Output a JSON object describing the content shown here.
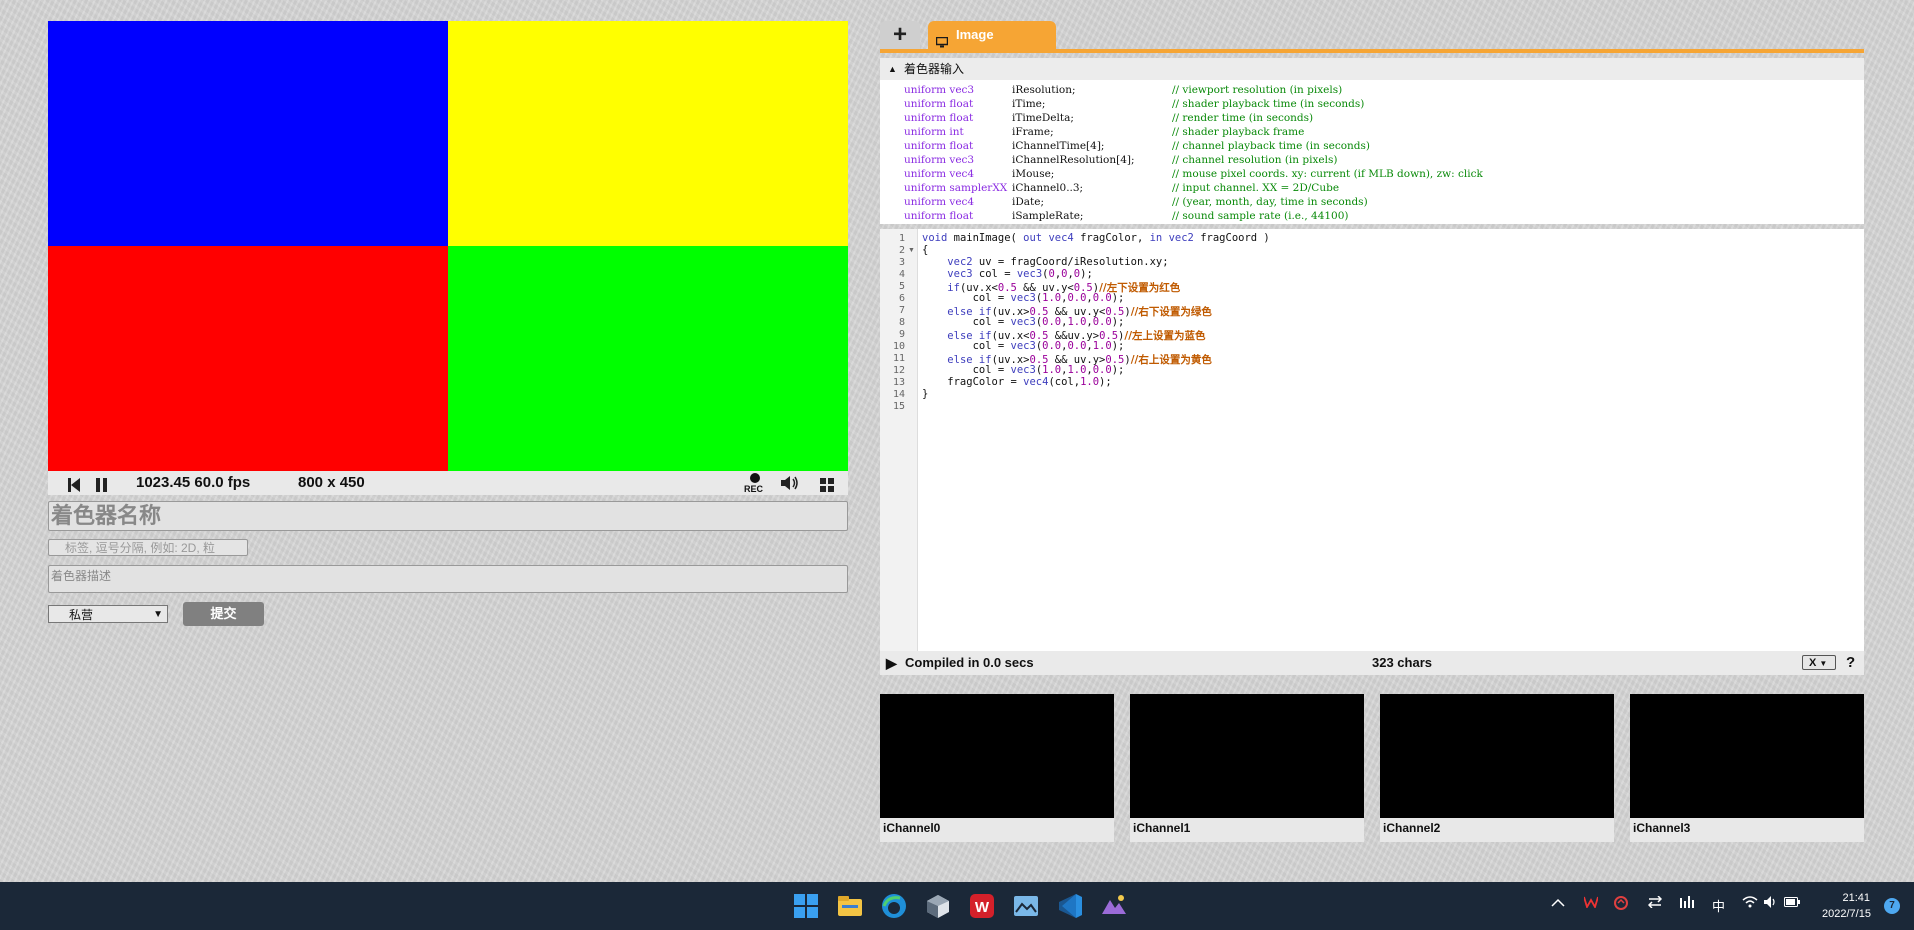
{
  "player": {
    "quadrant_colors": {
      "top_left": "#0000ff",
      "top_right": "#ffff00",
      "bottom_left": "#ff0000",
      "bottom_right": "#00ff00"
    },
    "fps_text": "1023.45 60.0 fps",
    "resolution_text": "800 x 450",
    "rec_label": "REC"
  },
  "form": {
    "name_placeholder": "着色器名称",
    "tags_placeholder": "标签, 逗号分隔, 例如: 2D, 粒",
    "description_placeholder": "着色器描述",
    "visibility_value": "私营",
    "submit_label": "提交"
  },
  "editor": {
    "tab_add_label": "+",
    "tab_label": "Image",
    "inputs_header": "着色器输入",
    "uniforms": [
      {
        "type": "uniform vec3",
        "name": "iResolution;",
        "comment": "// viewport resolution (in pixels)"
      },
      {
        "type": "uniform float",
        "name": "iTime;",
        "comment": "// shader playback time (in seconds)"
      },
      {
        "type": "uniform float",
        "name": "iTimeDelta;",
        "comment": "// render time (in seconds)"
      },
      {
        "type": "uniform int",
        "name": "iFrame;",
        "comment": "// shader playback frame"
      },
      {
        "type": "uniform float",
        "name": "iChannelTime[4];",
        "comment": "// channel playback time (in seconds)"
      },
      {
        "type": "uniform vec3",
        "name": "iChannelResolution[4];",
        "comment": "// channel resolution (in pixels)"
      },
      {
        "type": "uniform vec4",
        "name": "iMouse;",
        "comment": "// mouse pixel coords. xy: current (if MLB down), zw: click"
      },
      {
        "type": "uniform samplerXX",
        "name": "iChannel0..3;",
        "comment": "// input channel. XX = 2D/Cube"
      },
      {
        "type": "uniform vec4",
        "name": "iDate;",
        "comment": "// (year, month, day, time in seconds)"
      },
      {
        "type": "uniform float",
        "name": "iSampleRate;",
        "comment": "// sound sample rate (i.e., 44100)"
      }
    ],
    "code_lines": [
      "void mainImage( out vec4 fragColor, in vec2 fragCoord )",
      "{",
      "    vec2 uv = fragCoord/iResolution.xy;",
      "    vec3 col = vec3(0,0,0);",
      "    if(uv.x<0.5 && uv.y<0.5)//左下设置为红色",
      "        col = vec3(1.0,0.0,0.0);",
      "    else if(uv.x>0.5 && uv.y<0.5)//右下设置为绿色",
      "        col = vec3(0.0,1.0,0.0);",
      "    else if(uv.x<0.5 &&uv.y>0.5)//左上设置为蓝色",
      "        col = vec3(0.0,0.0,1.0);",
      "    else if(uv.x>0.5 && uv.y>0.5)//右上设置为黄色",
      "        col = vec3(1.0,1.0,0.0);",
      "    fragColor = vec4(col,1.0);",
      "}",
      ""
    ],
    "status_message": "Compiled in 0.0 secs",
    "char_count": "323 chars",
    "font_size_select": "X",
    "help_label": "?"
  },
  "channels": [
    {
      "label": "iChannel0"
    },
    {
      "label": "iChannel1"
    },
    {
      "label": "iChannel2"
    },
    {
      "label": "iChannel3"
    }
  ],
  "taskbar": {
    "apps": [
      "start-icon",
      "file-explorer-icon",
      "edge-icon",
      "3d-box-icon",
      "wps-icon",
      "image-viewer-icon",
      "vscode-icon",
      "mountain-app-icon"
    ],
    "tray_ime": "中",
    "clock_time": "21:41",
    "clock_date": "2022/7/15",
    "notification_count": "7"
  },
  "colors": {
    "accent_orange": "#f6a534",
    "keyword_purple": "#8a2be2",
    "comment_green": "#0a8a0a",
    "taskbar_bg": "#1b2838"
  }
}
